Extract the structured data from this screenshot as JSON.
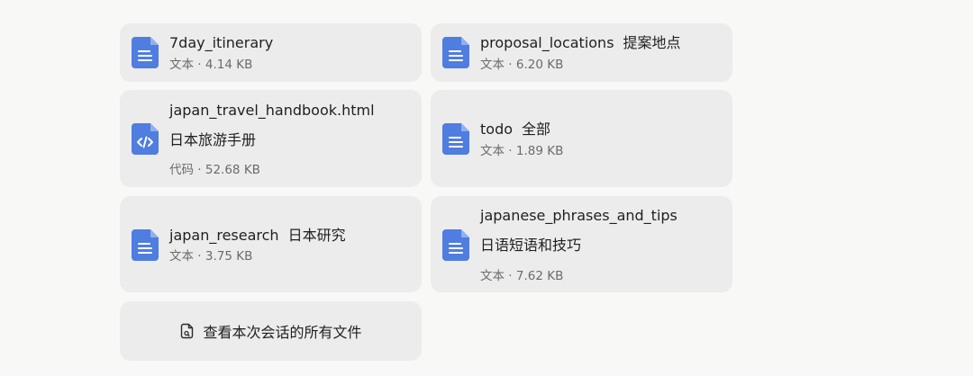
{
  "colors": {
    "doc_icon": "#4f7de0",
    "card_bg": "#ececec",
    "page_bg": "#f8f8f6",
    "meta_text": "#6b6b6b"
  },
  "files": [
    {
      "name": "7day_itinerary",
      "name_zh": "",
      "subtitle": "",
      "meta": "文本 · 4.14 KB",
      "icon": "document-icon"
    },
    {
      "name": "proposal_locations",
      "name_zh": "提案地点",
      "subtitle": "",
      "meta": "文本 · 6.20 KB",
      "icon": "document-icon"
    },
    {
      "name": "japan_travel_handbook.html",
      "name_zh": "",
      "subtitle": "日本旅游手册",
      "meta": "代码 · 52.68 KB",
      "icon": "code-file-icon"
    },
    {
      "name": "todo",
      "name_zh": "全部",
      "subtitle": "",
      "meta": "文本 · 1.89 KB",
      "icon": "document-icon"
    },
    {
      "name": "japan_research",
      "name_zh": "日本研究",
      "subtitle": "",
      "meta": "文本 · 3.75 KB",
      "icon": "document-icon"
    },
    {
      "name": "japanese_phrases_and_tips",
      "name_zh": "",
      "subtitle": "日语短语和技巧",
      "meta": "文本 · 7.62 KB",
      "icon": "document-icon"
    }
  ],
  "view_all": {
    "label": "查看本次会话的所有文件",
    "icon": "files-icon"
  }
}
